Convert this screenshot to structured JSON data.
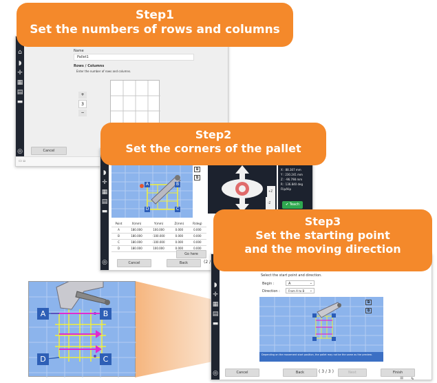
{
  "banners": {
    "step1": {
      "title": "Step1",
      "subtitle": "Set the numbers of rows and columns"
    },
    "step2": {
      "title": "Step2",
      "subtitle": "Set the corners of the pallet"
    },
    "step3": {
      "title": "Step3",
      "subtitle": "Set the starting point",
      "subtitle2": "and the moving direction"
    }
  },
  "step1_screen": {
    "name_label": "Name",
    "name_value": "Pallet1",
    "rows_label": "Rows / Columns",
    "rows_hint": "Enter the number of rows and columns.",
    "plus": "+",
    "count": "3",
    "minus": "−",
    "cancel": "Cancel"
  },
  "step2_screen": {
    "table_headers": [
      "Point",
      "X(mm)",
      "Y(mm)",
      "Z(mm)",
      "R(deg)"
    ],
    "rows": [
      [
        "A",
        "180.000",
        "100.000",
        "0.000",
        "0.000"
      ],
      [
        "B",
        "180.000",
        "-100.000",
        "0.000",
        "0.000"
      ],
      [
        "C",
        "180.000",
        "-100.000",
        "0.000",
        "0.000"
      ],
      [
        "D",
        "180.000",
        "100.000",
        "0.000",
        "0.000"
      ]
    ],
    "go_here": "Go here",
    "cancel": "Cancel",
    "back": "Back",
    "page": "(2 /",
    "readout": [
      "X :    88.307 mm",
      "Y :  230.241 mm",
      "Z :  -96.798 mm",
      "R :  136.840 deg",
      "Flip/Hip"
    ],
    "teach": "Teach",
    "jog_minus_z": "-Z",
    "jog_plus_z": "+Z"
  },
  "step3_screen": {
    "instruction": "Select the start point and direction.",
    "begin_label": "Begin :",
    "begin_value": "A",
    "direction_label": "Direction :",
    "direction_value": "From A to B",
    "note": "Depending on the movement start position, the pallet may not be the same as the preview.",
    "cancel": "Cancel",
    "back": "Back",
    "page": "( 3 / 3 )",
    "next": "Next",
    "finish": "Finish"
  },
  "zoom": {
    "corners": [
      "A",
      "B",
      "C",
      "D"
    ]
  },
  "colors": {
    "banner": "#f4892b",
    "grid_blue": "#8cb4ec",
    "corner_blue": "#2e5fb6",
    "arrow_magenta": "#e02ad0",
    "grid_yellow": "#f2ef3a",
    "sidebar": "#1f2530"
  }
}
